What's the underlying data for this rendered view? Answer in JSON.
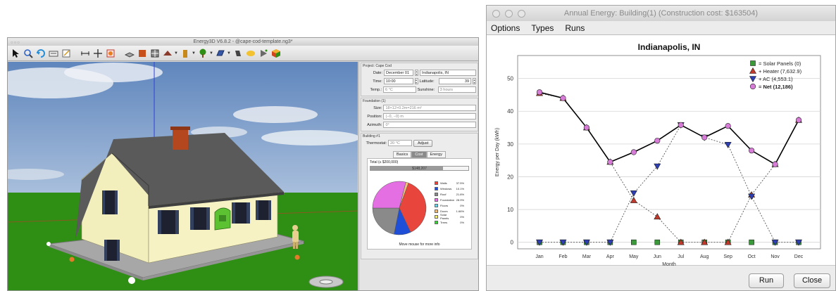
{
  "left_window": {
    "title": "Energy3D V6.8.2 - @cape-cod-template.ng3*",
    "project_group": "Project: Cape Cod",
    "date_label": "Date:",
    "date_value": "December 01",
    "city_value": "Indianapolis, IN",
    "time_label": "Time:",
    "time_value": "10:00",
    "latitude_label": "Latitude:",
    "latitude_value": "39",
    "temp_label": "Temp.:",
    "temp_value": "6 °C",
    "sunshine_label": "Sunshine:",
    "sunshine_value": "3 hours",
    "foundation_group": "Foundation (1)",
    "size_label": "Size:",
    "size_value": "18×12×0.2m=216 m²",
    "position_label": "Position:",
    "position_value": "(−0, −0) m",
    "azimuth_label": "Azimuth:",
    "azimuth_value": "0°",
    "building_group": "Building #1",
    "thermostat_label": "Thermostat:",
    "thermostat_value": "20 °C",
    "adjust_button": "Adjust",
    "tabs": [
      {
        "label": "Basics"
      },
      {
        "label": "Cost"
      },
      {
        "label": "Energy"
      }
    ],
    "cost_total_label": "Total (≤ $200,000)",
    "cost_total_value": "$148,207",
    "cost_fraction": 0.741,
    "pie_hint": "Move mouse for more info",
    "pie_legend": [
      {
        "name": "Walls",
        "pct": "37.5%",
        "color": "#e8453c"
      },
      {
        "name": "Windows",
        "pct": "10.1%",
        "color": "#1f4fd6"
      },
      {
        "name": "Roof",
        "pct": "21.8%",
        "color": "#8a8a8a"
      },
      {
        "name": "Foundation",
        "pct": "28.9%",
        "color": "#e36fe3"
      },
      {
        "name": "Floors",
        "pct": "0%",
        "color": "#6fd3e8"
      },
      {
        "name": "Doors",
        "pct": "1.66%",
        "color": "#f2c07a"
      },
      {
        "name": "Solar Panels",
        "pct": "0%",
        "color": "#f0f07a"
      },
      {
        "name": "Trees",
        "pct": "0%",
        "color": "#3fcf3f"
      }
    ]
  },
  "right_window": {
    "title": "Annual Energy: Building(1) (Construction cost: $163504)",
    "menu": [
      "Options",
      "Types",
      "Runs"
    ],
    "run_button": "Run",
    "close_button": "Close"
  },
  "colors": {
    "sky": "#6e92c4",
    "grass": "#2f8f14",
    "house_wall": "#f4f0bf",
    "roof": "#5e5e5e",
    "door": "#5cc232",
    "net_line": "#000000"
  },
  "chart_data": {
    "type": "line",
    "title": "Indianapolis, IN",
    "xlabel": "Month",
    "ylabel": "Energy per Day (kWh)",
    "categories": [
      "Jan",
      "Feb",
      "Mar",
      "Apr",
      "May",
      "Jun",
      "Jul",
      "Aug",
      "Sep",
      "Oct",
      "Nov",
      "Dec"
    ],
    "ylim": [
      -2,
      57
    ],
    "yticks": [
      0,
      10,
      20,
      30,
      40,
      50
    ],
    "grid": true,
    "legend_position": "top-right",
    "series": [
      {
        "name": "= Solar Panels (0)",
        "marker": "square",
        "color": "#3a9a3a",
        "values": [
          0,
          0,
          0,
          0,
          0,
          0,
          0,
          0,
          0,
          0,
          0,
          0
        ]
      },
      {
        "name": "+ Heater (7,632.9)",
        "marker": "triangle-up",
        "color": "#c0392b",
        "values": [
          45.5,
          44.0,
          35.0,
          24.5,
          12.8,
          7.8,
          0,
          0,
          0,
          14.5,
          23.8,
          37.3
        ]
      },
      {
        "name": "+ AC (4,553.1)",
        "marker": "triangle-down",
        "color": "#2d3fb3",
        "values": [
          0,
          0,
          0,
          0,
          15.0,
          23.2,
          35.8,
          32.0,
          29.8,
          14.0,
          0,
          0
        ]
      },
      {
        "name": "= Net (12,186)",
        "marker": "circle",
        "color": "#d67bd6",
        "values": [
          45.8,
          44.0,
          35.0,
          24.5,
          27.5,
          31.0,
          35.8,
          32.0,
          35.5,
          28.0,
          23.8,
          37.3
        ]
      }
    ]
  }
}
